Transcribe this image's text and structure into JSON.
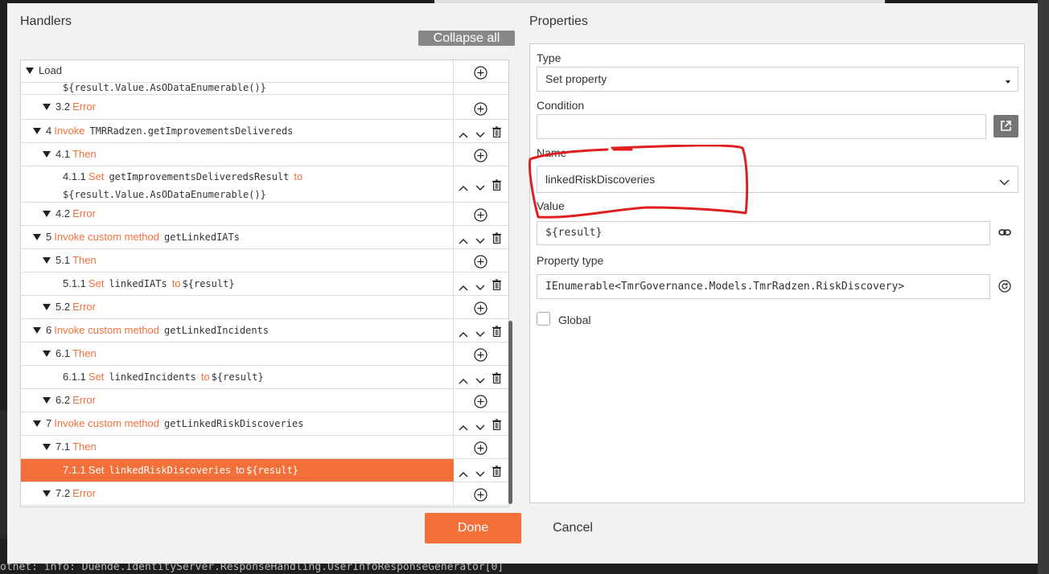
{
  "console_text": "otnet: info: Duende.IdentityServer.ResponseHandling.UserInfoResponseGenerator[0]",
  "handlers": {
    "title": "Handlers",
    "collapse_label": "Collapse all",
    "rows": {
      "load": {
        "title": "Load"
      },
      "r311": {
        "code": "${result.Value.AsODataEnumerable()}"
      },
      "r32": {
        "num": "3.2",
        "kw": "Error"
      },
      "r4": {
        "num": "4",
        "kw": "Invoke",
        "code": "TMRRadzen.getImprovementsDelivereds"
      },
      "r41": {
        "num": "4.1",
        "kw": "Then"
      },
      "r411": {
        "num": "4.1.1",
        "kw": "Set",
        "code": "getImprovementsDeliveredsResult",
        "kw2": "to",
        "code2": "${result.Value.AsODataEnumerable()}"
      },
      "r42": {
        "num": "4.2",
        "kw": "Error"
      },
      "r5": {
        "num": "5",
        "kw": "Invoke custom method",
        "code": "getLinkedIATs"
      },
      "r51": {
        "num": "5.1",
        "kw": "Then"
      },
      "r511": {
        "num": "5.1.1",
        "kw": "Set",
        "code": "linkedIATs",
        "kw2": "to",
        "code2": "${result}"
      },
      "r52": {
        "num": "5.2",
        "kw": "Error"
      },
      "r6": {
        "num": "6",
        "kw": "Invoke custom method",
        "code": "getLinkedIncidents"
      },
      "r61": {
        "num": "6.1",
        "kw": "Then"
      },
      "r611": {
        "num": "6.1.1",
        "kw": "Set",
        "code": "linkedIncidents",
        "kw2": "to",
        "code2": "${result}"
      },
      "r62": {
        "num": "6.2",
        "kw": "Error"
      },
      "r7": {
        "num": "7",
        "kw": "Invoke custom method",
        "code": "getLinkedRiskDiscoveries"
      },
      "r71": {
        "num": "7.1",
        "kw": "Then"
      },
      "r711": {
        "num": "7.1.1",
        "kw": "Set",
        "code": "linkedRiskDiscoveries",
        "kw2": "to",
        "code2": "${result}"
      },
      "r72": {
        "num": "7.2",
        "kw": "Error"
      }
    }
  },
  "properties": {
    "title": "Properties",
    "type_label": "Type",
    "type_value": "Set property",
    "condition_label": "Condition",
    "condition_value": "",
    "name_label": "Name",
    "name_value": "linkedRiskDiscoveries",
    "value_label": "Value",
    "value_value": "${result}",
    "property_type_label": "Property type",
    "property_type_value": "IEnumerable<TmrGovernance.Models.TmrRadzen.RiskDiscovery>",
    "global_label": "Global"
  },
  "footer": {
    "done_label": "Done",
    "cancel_label": "Cancel"
  },
  "colors": {
    "accent": "#f4703b",
    "annotation": "#e02020",
    "panel": "#f2f2f2"
  }
}
